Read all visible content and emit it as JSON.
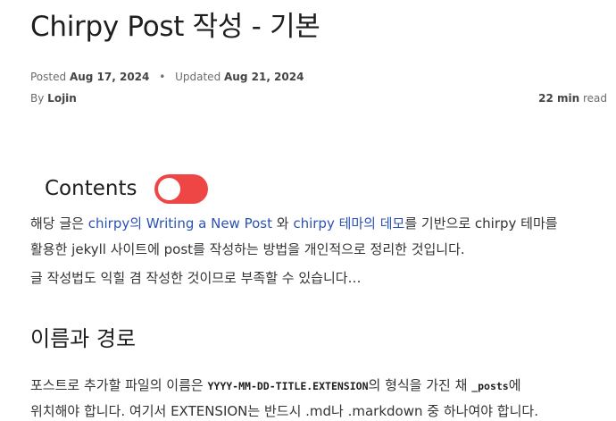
{
  "post": {
    "title": "Chirpy Post 작성 - 기본",
    "posted_label": "Posted",
    "posted_date": "Aug 17, 2024",
    "meta_separator": "•",
    "updated_label": "Updated",
    "updated_date": "Aug 21, 2024",
    "by_label": "By",
    "author": "Lojin",
    "read_time_value": "22 min",
    "read_time_suffix": "read"
  },
  "toc": {
    "label": "Contents",
    "toggle_state": "on",
    "toggle_color": "#ee4545"
  },
  "intro": {
    "line1_prefix": "해당 글은 ",
    "link1": "chirpy의 Writing a New Post",
    "line1_mid": " 와 ",
    "link2": "chirpy 테마의 데모",
    "line1_suffix": "를 기반으로 chirpy 테마를",
    "line2": "활용한 jekyll 사이트에 post를 작성하는 방법을 개인적으로 정리한 것입니다.",
    "line3": "글 작성법도 익힐 겸 작성한 것이므로 부족할 수 있습니다…"
  },
  "section": {
    "heading": "이름과 경로",
    "p_prefix": "포스트로 추가할 파일의 이름은 ",
    "code1": "YYYY-MM-DD-TITLE.EXTENSION",
    "p_mid": "의 형식을 가진 채 ",
    "code2": "_posts",
    "p_suffix": "에",
    "cut_line": "위치해야 합니다. 여기서 EXTENSION는 반드시 .md나 .markdown 중 하나여야 합니다."
  },
  "colors": {
    "link": "#2a53b5",
    "text": "#333333",
    "toggle": "#ee4545"
  }
}
